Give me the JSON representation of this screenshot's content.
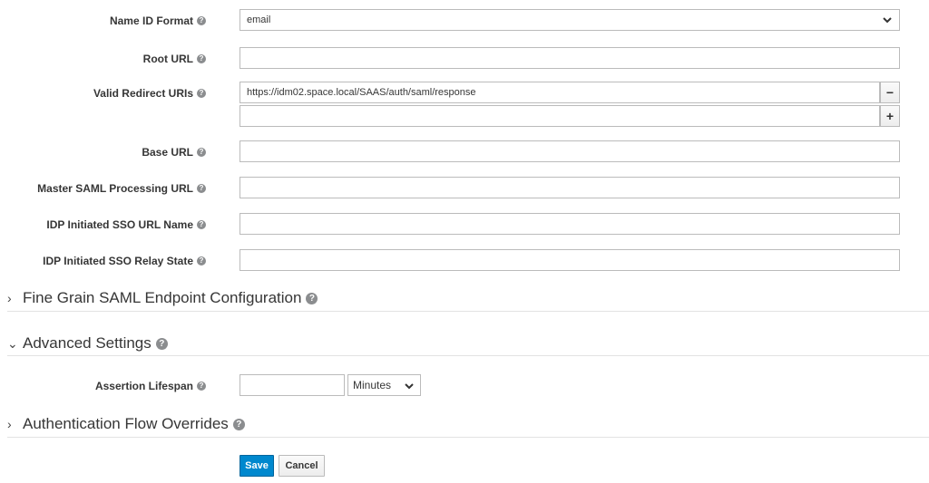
{
  "fields": {
    "name_id_format": {
      "label": "Name ID Format",
      "value": "email"
    },
    "root_url": {
      "label": "Root URL",
      "value": ""
    },
    "valid_redirect_uris": {
      "label": "Valid Redirect URIs",
      "values": [
        "https://idm02.space.local/SAAS/auth/saml/response",
        ""
      ]
    },
    "base_url": {
      "label": "Base URL",
      "value": ""
    },
    "master_saml_url": {
      "label": "Master SAML Processing URL",
      "value": ""
    },
    "idp_sso_url_name": {
      "label": "IDP Initiated SSO URL Name",
      "value": ""
    },
    "idp_sso_relay_state": {
      "label": "IDP Initiated SSO Relay State",
      "value": ""
    },
    "assertion_lifespan": {
      "label": "Assertion Lifespan",
      "value": "",
      "unit": "Minutes"
    }
  },
  "sections": {
    "fine_grain": {
      "title": "Fine Grain SAML Endpoint Configuration",
      "caret": "›"
    },
    "advanced": {
      "title": "Advanced Settings",
      "caret": "⌄"
    },
    "auth_flow": {
      "title": "Authentication Flow Overrides",
      "caret": "›"
    }
  },
  "icons": {
    "help": "?",
    "remove": "−",
    "add": "+"
  },
  "buttons": {
    "save": "Save",
    "cancel": "Cancel"
  },
  "colors": {
    "primary": "#0088ce",
    "border": "#bbbbbb",
    "text": "#363636"
  }
}
